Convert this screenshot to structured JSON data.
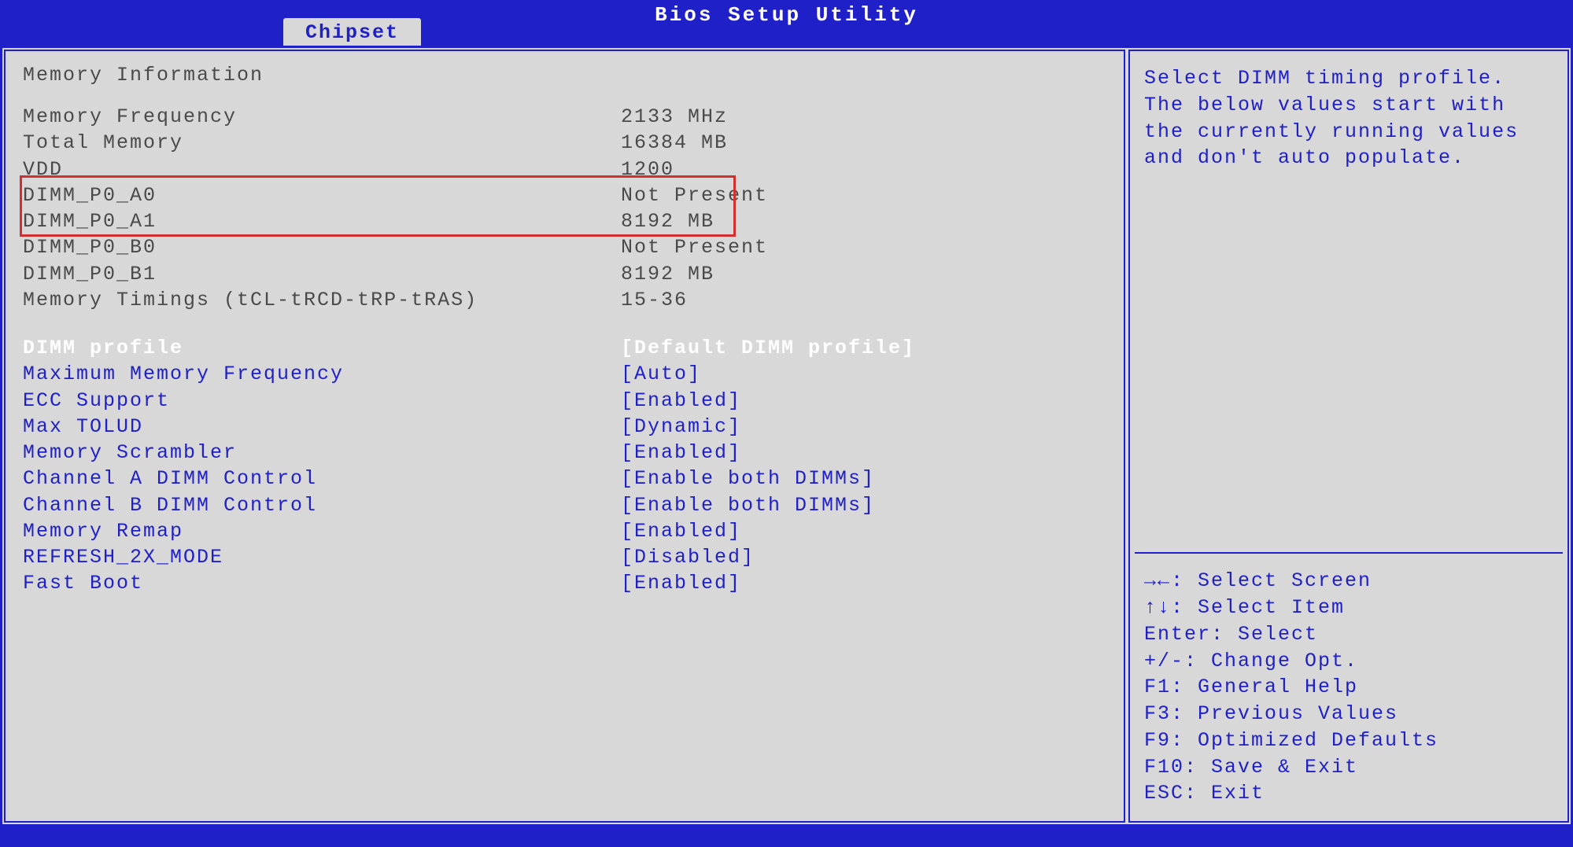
{
  "header": {
    "title": "Bios Setup Utility",
    "tab": "Chipset"
  },
  "left": {
    "section_title": "Memory Information",
    "info_rows": [
      {
        "label": "Memory Frequency",
        "value": "2133 MHz"
      },
      {
        "label": "Total Memory",
        "value": "16384 MB"
      },
      {
        "label": "VDD",
        "value": "1200"
      },
      {
        "label": "DIMM_P0_A0",
        "value": "Not Present"
      },
      {
        "label": "DIMM_P0_A1",
        "value": "8192 MB"
      },
      {
        "label": "DIMM_P0_B0",
        "value": "Not Present"
      },
      {
        "label": "DIMM_P0_B1",
        "value": "8192 MB"
      },
      {
        "label": "Memory Timings (tCL-tRCD-tRP-tRAS)",
        "value": "15-36"
      }
    ],
    "selected_setting": {
      "label": "DIMM profile",
      "value": "[Default DIMM profile]"
    },
    "settings": [
      {
        "label": "Maximum Memory Frequency",
        "value": "[Auto]"
      },
      {
        "label": "ECC Support",
        "value": "[Enabled]"
      },
      {
        "label": "Max TOLUD",
        "value": "[Dynamic]"
      },
      {
        "label": "Memory Scrambler",
        "value": "[Enabled]"
      },
      {
        "label": "Channel A DIMM Control",
        "value": "[Enable both DIMMs]"
      },
      {
        "label": "Channel B DIMM Control",
        "value": "[Enable both DIMMs]"
      },
      {
        "label": "Memory Remap",
        "value": "[Enabled]"
      },
      {
        "label": "REFRESH_2X_MODE",
        "value": "[Disabled]"
      },
      {
        "label": "Fast Boot",
        "value": "[Enabled]"
      }
    ]
  },
  "right": {
    "help_text": "Select DIMM timing profile. The below values start with the currently running values and don't auto populate.",
    "keys": [
      "→←: Select Screen",
      "↑↓: Select Item",
      "Enter: Select",
      "+/-: Change Opt.",
      "F1: General Help",
      "F3: Previous Values",
      "F9: Optimized Defaults",
      "F10: Save & Exit",
      "ESC: Exit"
    ]
  }
}
